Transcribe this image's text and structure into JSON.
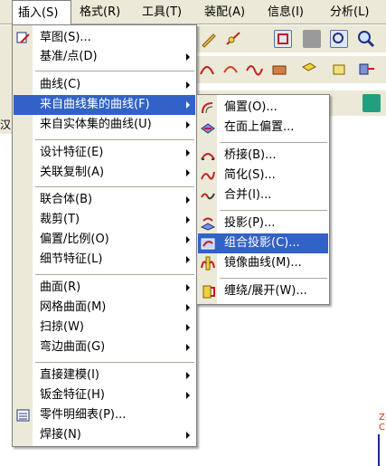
{
  "menubar": {
    "items": [
      {
        "label": "插入(S)"
      },
      {
        "label": "格式(R)"
      },
      {
        "label": "工具(T)"
      },
      {
        "label": "装配(A)"
      },
      {
        "label": "信息(I)"
      },
      {
        "label": "分析(L)"
      }
    ]
  },
  "insert_menu": {
    "items": [
      {
        "label": "草图(S)..."
      },
      {
        "label": "基准/点(D)"
      },
      {
        "label": "曲线(C)"
      },
      {
        "label": "来自曲线集的曲线(F)"
      },
      {
        "label": "来自实体集的曲线(U)"
      },
      {
        "label": "设计特征(E)"
      },
      {
        "label": "关联复制(A)"
      },
      {
        "label": "联合体(B)"
      },
      {
        "label": "裁剪(T)"
      },
      {
        "label": "偏置/比例(O)"
      },
      {
        "label": "细节特征(L)"
      },
      {
        "label": "曲面(R)"
      },
      {
        "label": "网格曲面(M)"
      },
      {
        "label": "扫掠(W)"
      },
      {
        "label": "弯边曲面(G)"
      },
      {
        "label": "直接建模(I)"
      },
      {
        "label": "钣金特征(H)"
      },
      {
        "label": "零件明细表(P)..."
      },
      {
        "label": "焊接(N)"
      }
    ]
  },
  "submenu": {
    "items": [
      {
        "label": "偏置(O)..."
      },
      {
        "label": "在面上偏置..."
      },
      {
        "label": "桥接(B)..."
      },
      {
        "label": "简化(S)..."
      },
      {
        "label": "合并(I)..."
      },
      {
        "label": "投影(P)..."
      },
      {
        "label": "组合投影(C)..."
      },
      {
        "label": "镜像曲线(M)..."
      },
      {
        "label": "缠绕/展开(W)..."
      }
    ]
  },
  "canvas": {
    "axis_label": "Z-C",
    "side_tab_label": "汉"
  },
  "colors": {
    "highlight": "#3162c5",
    "menu_bg": "#ffffff",
    "chrome": "#ece9d8"
  }
}
